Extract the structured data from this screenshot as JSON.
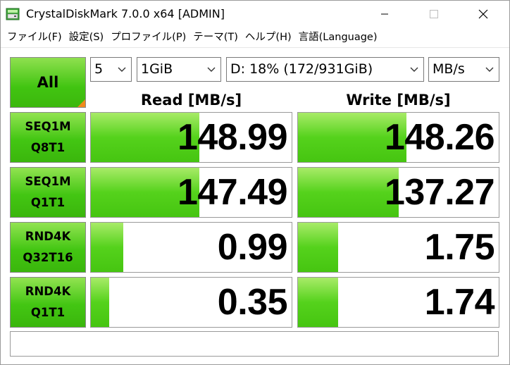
{
  "window": {
    "title": "CrystalDiskMark 7.0.0 x64 [ADMIN]",
    "icons": {
      "app": "crystaldiskmark-icon",
      "minimize": "minimize-icon",
      "maximize": "maximize-icon",
      "close": "close-icon"
    }
  },
  "menu": [
    {
      "label": "ファイル(F)"
    },
    {
      "label": "設定(S)"
    },
    {
      "label": "プロファイル(P)"
    },
    {
      "label": "テーマ(T)"
    },
    {
      "label": "ヘルプ(H)"
    },
    {
      "label": "言語(Language)"
    }
  ],
  "controls": {
    "all_label": "All",
    "count": "5",
    "size": "1GiB",
    "drive": "D: 18% (172/931GiB)",
    "unit": "MB/s"
  },
  "headers": {
    "read": "Read [MB/s]",
    "write": "Write [MB/s]"
  },
  "tests": [
    {
      "line1": "SEQ1M",
      "line2": "Q8T1",
      "read": "148.99",
      "read_fill": 0.54,
      "write": "148.26",
      "write_fill": 0.54
    },
    {
      "line1": "SEQ1M",
      "line2": "Q1T1",
      "read": "147.49",
      "read_fill": 0.54,
      "write": "137.27",
      "write_fill": 0.5
    },
    {
      "line1": "RND4K",
      "line2": "Q32T16",
      "read": "0.99",
      "read_fill": 0.16,
      "write": "1.75",
      "write_fill": 0.2
    },
    {
      "line1": "RND4K",
      "line2": "Q1T1",
      "read": "0.35",
      "read_fill": 0.09,
      "write": "1.74",
      "write_fill": 0.2
    }
  ],
  "colors": {
    "bar_green": "#4ccb15",
    "corner_orange": "#f08a1c"
  },
  "comment": ""
}
